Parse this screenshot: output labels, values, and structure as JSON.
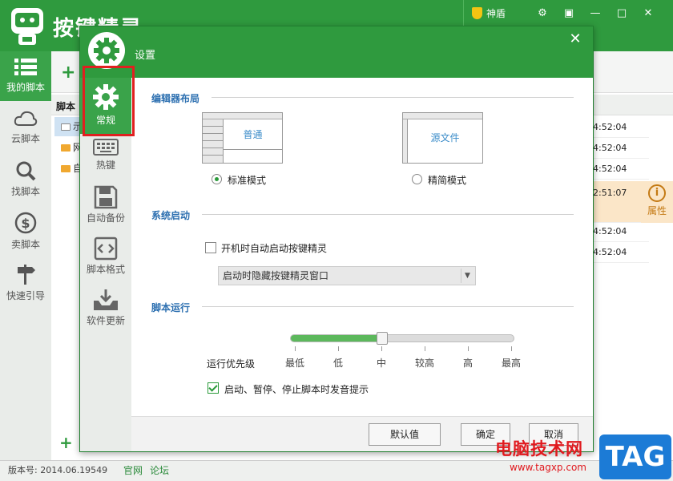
{
  "app": {
    "title": "按键精灵",
    "shendun": "神盾"
  },
  "left_nav": [
    {
      "label": "我的脚本",
      "icon": "list-icon"
    },
    {
      "label": "云脚本",
      "icon": "cloud-icon"
    },
    {
      "label": "找脚本",
      "icon": "search-icon"
    },
    {
      "label": "卖脚本",
      "icon": "dollar-icon"
    },
    {
      "label": "快速引导",
      "icon": "signpost-icon"
    }
  ],
  "script_list": {
    "header": "脚本 I",
    "tree": [
      "示",
      "网",
      "自"
    ],
    "times": [
      "4:52:04",
      "4:52:04",
      "4:52:04",
      "2:51:07",
      "4:52:04",
      "4:52:04"
    ],
    "property_label": "属性"
  },
  "status_bar": {
    "version": "版本号: 2014.06.19549",
    "link_official": "官网",
    "link_forum": "论坛"
  },
  "dialog": {
    "title": "设置",
    "nav": [
      {
        "label": "常规",
        "icon": "gear-icon"
      },
      {
        "label": "热键",
        "icon": "keyboard-icon"
      },
      {
        "label": "自动备份",
        "icon": "floppy-icon"
      },
      {
        "label": "脚本格式",
        "icon": "code-icon"
      },
      {
        "label": "软件更新",
        "icon": "update-icon"
      }
    ],
    "layout_section": "编辑器布局",
    "preview_normal": "普通",
    "preview_source": "源文件",
    "radio_standard": "标准模式",
    "radio_simple": "精简模式",
    "startup_section": "系统启动",
    "startup_checkbox": "开机时自动启动按键精灵",
    "startup_select": "启动时隐藏按键精灵窗口",
    "run_section": "脚本运行",
    "priority_label": "运行优先级",
    "priority_levels": [
      "最低",
      "低",
      "中",
      "较高",
      "高",
      "最高"
    ],
    "priority_value": "中",
    "sound_checkbox": "启动、暂停、停止脚本时发音提示",
    "btn_default": "默认值",
    "btn_ok": "确定",
    "btn_cancel": "取消"
  },
  "watermark": {
    "text": "电脑技术网",
    "url": "www.tagxp.com",
    "tag": "TAG"
  }
}
